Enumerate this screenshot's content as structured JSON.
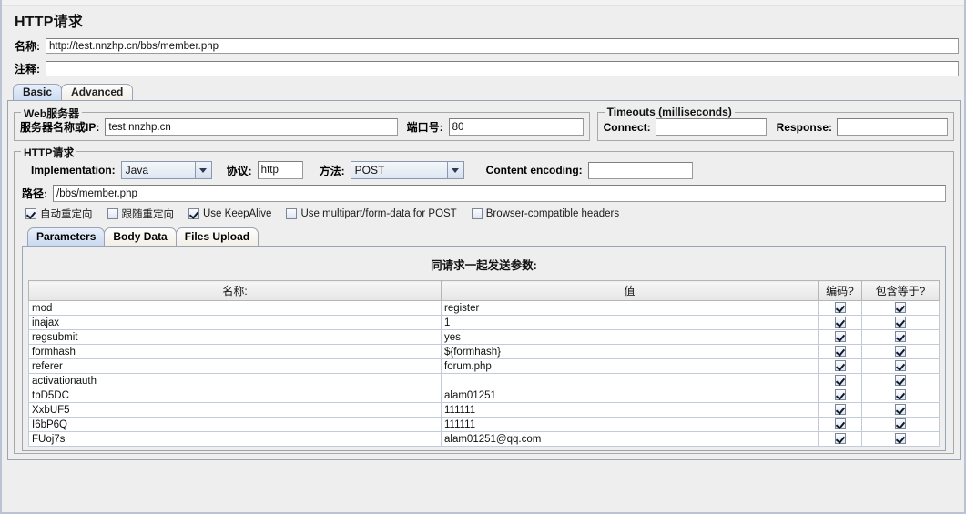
{
  "window": {
    "title": "HTTP请求"
  },
  "header": {
    "name_label": "名称:",
    "name_value": "http://test.nnzhp.cn/bbs/member.php",
    "comment_label": "注释:",
    "comment_value": ""
  },
  "outer_tabs": [
    {
      "label": "Basic",
      "selected": true
    },
    {
      "label": "Advanced",
      "selected": false
    }
  ],
  "web_server": {
    "group_title": "Web服务器",
    "server_label": "服务器名称或IP:",
    "server_value": "test.nnzhp.cn",
    "port_label": "端口号:",
    "port_value": "80"
  },
  "timeouts": {
    "group_title": "Timeouts (milliseconds)",
    "connect_label": "Connect:",
    "connect_value": "",
    "response_label": "Response:",
    "response_value": ""
  },
  "http_request": {
    "group_title": "HTTP请求",
    "implementation_label": "Implementation:",
    "implementation_value": "Java",
    "protocol_label": "协议:",
    "protocol_value": "http",
    "method_label": "方法:",
    "method_value": "POST",
    "content_encoding_label": "Content encoding:",
    "content_encoding_value": "",
    "path_label": "路径:",
    "path_value": "/bbs/member.php",
    "checkboxes": [
      {
        "label": "自动重定向",
        "checked": true
      },
      {
        "label": "跟随重定向",
        "checked": false
      },
      {
        "label": "Use KeepAlive",
        "checked": true
      },
      {
        "label": "Use multipart/form-data for POST",
        "checked": false
      },
      {
        "label": "Browser-compatible headers",
        "checked": false
      }
    ]
  },
  "inner_tabs": [
    {
      "label": "Parameters",
      "selected": true
    },
    {
      "label": "Body Data",
      "selected": false
    },
    {
      "label": "Files Upload",
      "selected": false
    }
  ],
  "params_table": {
    "caption": "同请求一起发送参数:",
    "columns": [
      "名称:",
      "值",
      "编码?",
      "包含等于?"
    ],
    "rows": [
      {
        "name": "mod",
        "value": "register",
        "encode": true,
        "include_equals": true
      },
      {
        "name": "inajax",
        "value": "1",
        "encode": true,
        "include_equals": true
      },
      {
        "name": "regsubmit",
        "value": "yes",
        "encode": true,
        "include_equals": true
      },
      {
        "name": "formhash",
        "value": "${formhash}",
        "encode": true,
        "include_equals": true
      },
      {
        "name": "referer",
        "value": "forum.php",
        "encode": true,
        "include_equals": true
      },
      {
        "name": "activationauth",
        "value": "",
        "encode": true,
        "include_equals": true
      },
      {
        "name": "tbD5DC",
        "value": "alam01251",
        "encode": true,
        "include_equals": true
      },
      {
        "name": "XxbUF5",
        "value": "111111",
        "encode": true,
        "include_equals": true
      },
      {
        "name": "I6bP6Q",
        "value": "111111",
        "encode": true,
        "include_equals": true
      },
      {
        "name": "FUoj7s",
        "value": "alam01251@qq.com",
        "encode": true,
        "include_equals": true
      }
    ]
  },
  "colors": {
    "panel_bg": "#eeeeee",
    "tab_selected": "#ccdcf2",
    "border": "#9aa4b4",
    "field_bg": "#ffffff"
  }
}
